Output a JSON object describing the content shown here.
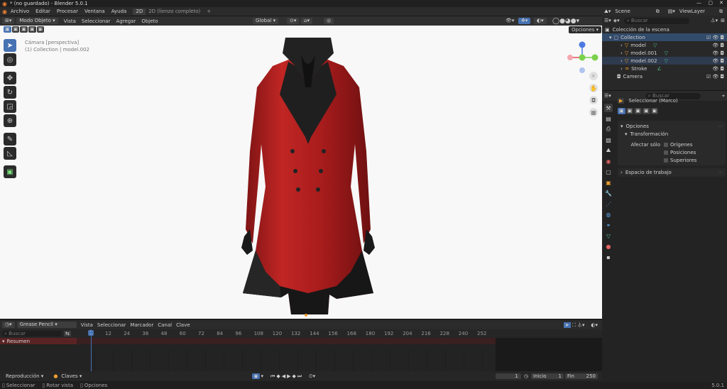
{
  "app": {
    "title": "* (no guardado) - Blender 5.0.1",
    "version": "5.0.1"
  },
  "menu": {
    "file": "Archivo",
    "edit": "Editar",
    "render": "Procesar",
    "window": "Ventana",
    "help": "Ayuda"
  },
  "workspace_tabs": [
    {
      "label": "2D"
    },
    {
      "label": "2D (lienzo completo)"
    }
  ],
  "scene": {
    "name": "Scene",
    "view_layer": "ViewLayer"
  },
  "viewport_header": {
    "mode": "Modo Objeto",
    "view": "Vista",
    "select": "Seleccionar",
    "add": "Agregar",
    "object": "Objeto",
    "orientation": "Global",
    "options": "Opciones"
  },
  "viewport_overlay": {
    "camera": "Cámara [perspectiva]",
    "collection": "(1) Collection | model.002"
  },
  "outliner": {
    "search_placeholder": "Buscar",
    "root": "Colección de la escena",
    "items": [
      {
        "label": "Collection"
      },
      {
        "label": "model"
      },
      {
        "label": "model.001"
      },
      {
        "label": "model.002"
      },
      {
        "label": "Stroke"
      },
      {
        "label": "Camera"
      }
    ]
  },
  "properties": {
    "search_placeholder": "Buscar",
    "tool_name": "Seleccionar (Marco)",
    "options_panel": "Opciones",
    "transform_panel": "Transformación",
    "affect_only": "Afectar sólo",
    "checkbox_origins": "Orígenes",
    "checkbox_positions": "Posiciones",
    "checkbox_parents": "Superiores",
    "workspace_panel": "Espacio de trabajo"
  },
  "timeline": {
    "editor": "Grease Pencil",
    "view": "Vista",
    "select": "Seleccionar",
    "marker": "Marcador",
    "channel": "Canal",
    "key": "Clave",
    "search_placeholder": "Buscar",
    "summary": "Resumen",
    "current_frame": "1",
    "ticks": [
      "12",
      "24",
      "36",
      "48",
      "60",
      "72",
      "84",
      "96",
      "108",
      "120",
      "132",
      "144",
      "156",
      "168",
      "180",
      "192",
      "204",
      "216",
      "228",
      "240",
      "252"
    ]
  },
  "playback": {
    "playback": "Reproducción",
    "keys": "Claves",
    "frame": "1",
    "start_label": "Inicio",
    "start": "1",
    "end_label": "Fin",
    "end": "250"
  },
  "status": {
    "select": "Seleccionar",
    "rotate": "Rotar vista",
    "options": "Opciones",
    "version": "5.0.1"
  },
  "colors": {
    "accent": "#4772b3",
    "coat": "#b3201f",
    "coat_dark": "#6e0f10",
    "leather": "#1f1f1f"
  }
}
